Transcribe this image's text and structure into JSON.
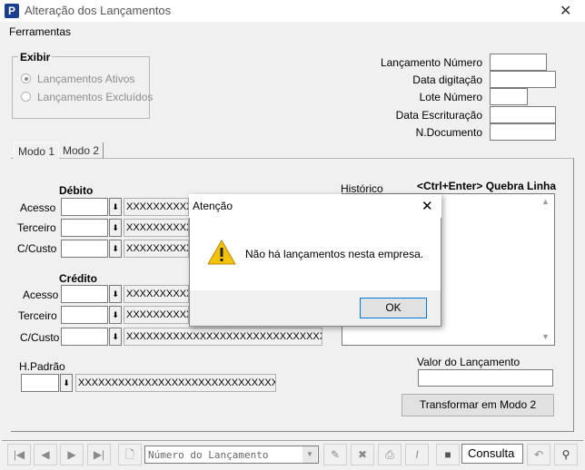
{
  "window": {
    "title": "Alteração dos Lançamentos",
    "app_icon_letter": "P",
    "close_symbol": "✕"
  },
  "menu": {
    "items": [
      "Ferramentas"
    ]
  },
  "exibir": {
    "title": "Exibir",
    "options": [
      "Lançamentos Ativos",
      "Lançamentos Excluídos"
    ],
    "selected": 0
  },
  "header_fields": [
    {
      "label": "Lançamento Número",
      "value": ""
    },
    {
      "label": "Data digitação",
      "value": ""
    },
    {
      "label": "Lote Número",
      "value": ""
    },
    {
      "label": "Data Escrituração",
      "value": ""
    },
    {
      "label": "N.Documento",
      "value": ""
    }
  ],
  "tabs": [
    {
      "label": "Modo 1"
    },
    {
      "label": "Modo 2"
    }
  ],
  "debito": {
    "title": "Débito",
    "rows": [
      {
        "label": "Acesso",
        "desc": "XXXXXXXXXXXXXXXXXXXXXXXXXXXXXXXXX"
      },
      {
        "label": "Terceiro",
        "desc": "XXXXXXXXXXXXXXXXXXXXXXXXXXXXXXXXX"
      },
      {
        "label": "C/Custo",
        "desc": "XXXXXXXXXXXXXXXXXXXXXXXXXXXXXXXXX"
      }
    ]
  },
  "credito": {
    "title": "Crédito",
    "rows": [
      {
        "label": "Acesso",
        "desc": "XXXXXXXXXXXXXXXXXXXXXXXXXXXXXXXXX"
      },
      {
        "label": "Terceiro",
        "desc": "XXXXXXXXXXXXXXXXXXXXXXXXXXXXXXXXX"
      },
      {
        "label": "C/Custo",
        "desc": "XXXXXXXXXXXXXXXXXXXXXXXXXXXXXXXXX"
      }
    ]
  },
  "historico": {
    "label": "Histórico",
    "hint": "<Ctrl+Enter> Quebra Linha"
  },
  "h_padrao": {
    "label": "H.Padrão",
    "desc": "XXXXXXXXXXXXXXXXXXXXXXXXXXXXXX"
  },
  "valor": {
    "label": "Valor do Lançamento",
    "value": ""
  },
  "transformar_button": "Transformar em  Modo 2",
  "navbar": {
    "combo_placeholder": "Número do Lançamento",
    "consulta": "Consulta"
  },
  "dialog": {
    "title": "Atenção",
    "message": "Não há lançamentos nesta empresa.",
    "ok_label": "OK",
    "close_symbol": "✕"
  }
}
